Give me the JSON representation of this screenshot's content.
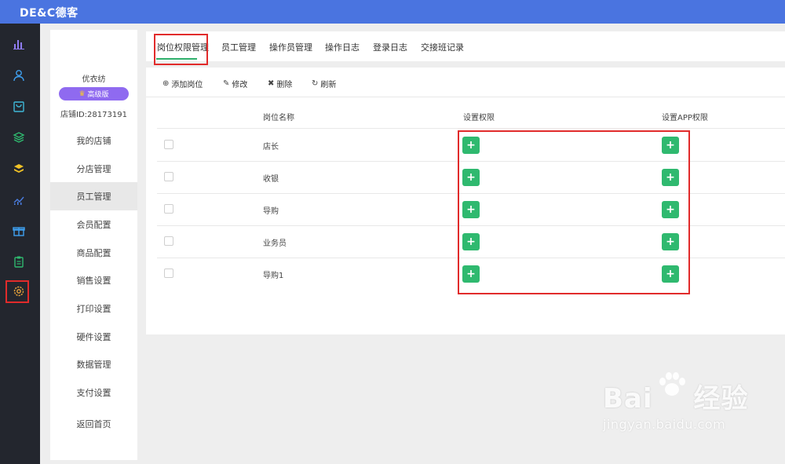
{
  "app": {
    "logo": "DE&C德客"
  },
  "iconbar": {
    "icons": [
      {
        "name": "bar-chart-icon",
        "color": "#8f7cf2"
      },
      {
        "name": "user-icon",
        "color": "#3fa0f0"
      },
      {
        "name": "bag-icon",
        "color": "#3fb8d8"
      },
      {
        "name": "layers-icon",
        "color": "#2fb96f"
      },
      {
        "name": "stack-icon",
        "color": "#f2c227"
      },
      {
        "name": "trend-chart-icon",
        "color": "#4a7de0"
      },
      {
        "name": "gift-icon",
        "color": "#3fa0f0"
      },
      {
        "name": "clipboard-icon",
        "color": "#2fb96f"
      },
      {
        "name": "gear-icon",
        "color": "#e8a23a"
      }
    ]
  },
  "store": {
    "name": "优衣纺",
    "badge": "高级版",
    "id_label": "店铺ID:28173191"
  },
  "menu": {
    "items": [
      "我的店铺",
      "分店管理",
      "员工管理",
      "会员配置",
      "商品配置",
      "销售设置",
      "打印设置",
      "硬件设置",
      "数据管理",
      "支付设置"
    ],
    "back": "返回首页",
    "active_index": 2
  },
  "tabs": [
    "岗位权限管理",
    "员工管理",
    "操作员管理",
    "操作日志",
    "登录日志",
    "交接班记录"
  ],
  "toolbar": {
    "add": "添加岗位",
    "edit": "修改",
    "delete": "删除",
    "refresh": "刷新"
  },
  "table": {
    "columns": [
      "岗位名称",
      "设置权限",
      "设置APP权限"
    ],
    "rows": [
      "店长",
      "收银",
      "导购",
      "业务员",
      "导购1"
    ]
  },
  "colors": {
    "topbar": "#4a74e0",
    "accent_green": "#2fb96f",
    "highlight_red": "#e12b2b",
    "badge_purple": "#8f6af0"
  },
  "watermark": {
    "brand": "Bai",
    "brand_tail": "经验",
    "url": "jingyan.baidu.com"
  }
}
